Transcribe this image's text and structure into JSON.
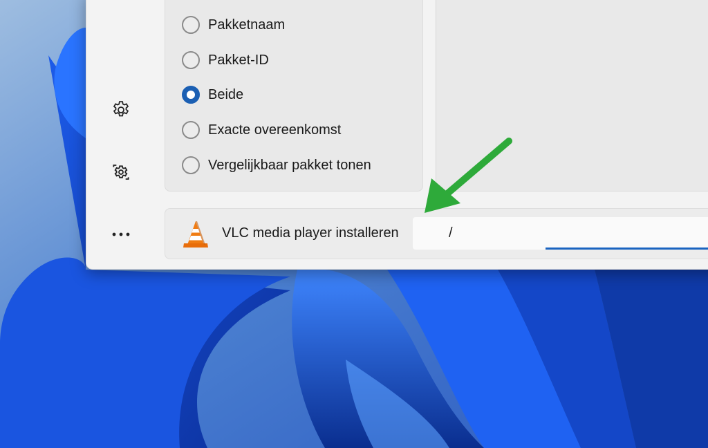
{
  "sidebar": {
    "items": [
      {
        "icon": "gear-icon"
      },
      {
        "icon": "settings-sync-icon"
      },
      {
        "icon": "more-icon"
      }
    ]
  },
  "search_options": {
    "items": [
      {
        "label": "Pakketnaam",
        "checked": false
      },
      {
        "label": "Pakket-ID",
        "checked": false
      },
      {
        "label": "Beide",
        "checked": true
      },
      {
        "label": "Exacte overeenkomst",
        "checked": false
      },
      {
        "label": "Vergelijkbaar pakket tonen",
        "checked": false
      }
    ]
  },
  "status": {
    "app_icon": "vlc-cone-icon",
    "label": "VLC media player installeren",
    "progress_text": "/",
    "progress_fraction": 1.0
  },
  "colors": {
    "accent": "#1a64c0",
    "annotation_arrow": "#2eaa3a"
  }
}
